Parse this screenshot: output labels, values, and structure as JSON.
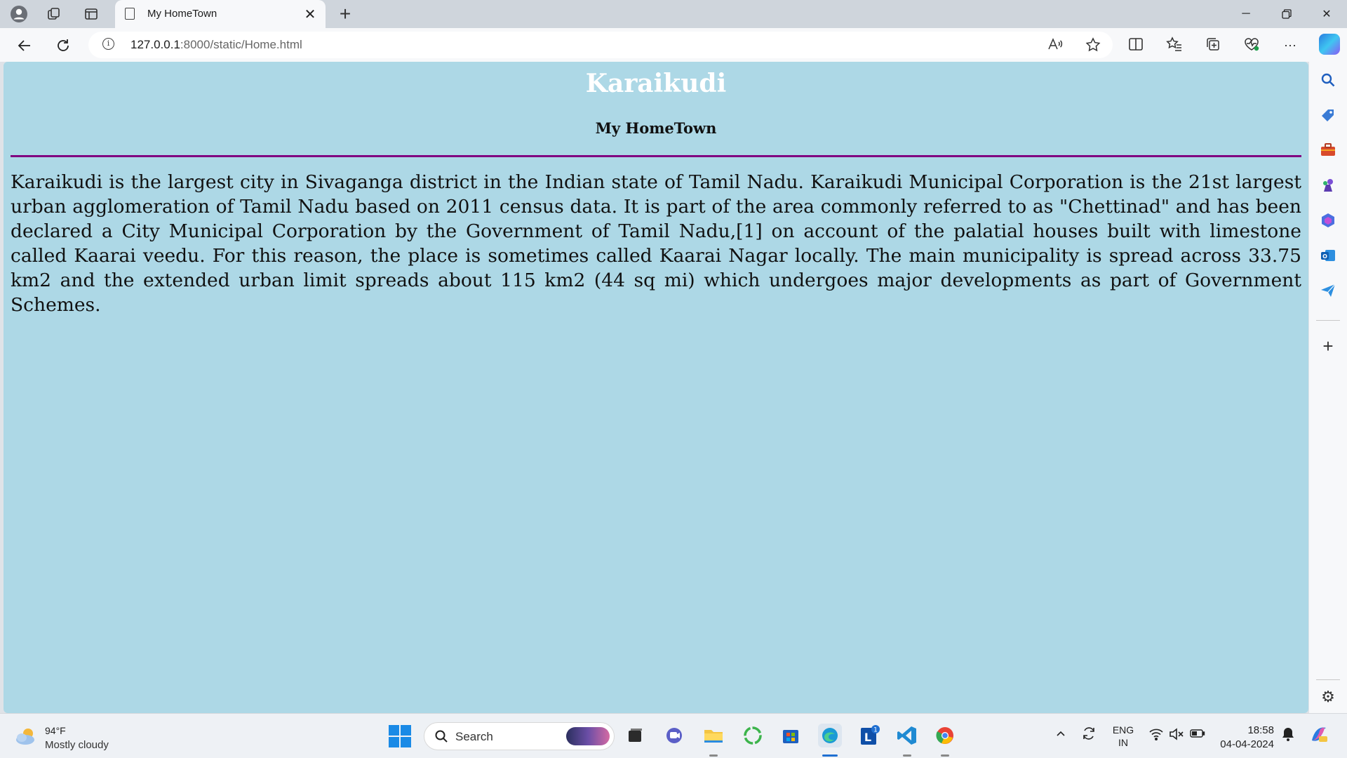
{
  "browser": {
    "tab": {
      "title": "My HomeTown"
    },
    "address": {
      "url_host": "127.0.0.1",
      "url_rest": ":8000/static/Home.html"
    }
  },
  "page": {
    "heading": "Karaikudi",
    "subheading": "My HomeTown",
    "paragraph": "Karaikudi is the largest city in Sivaganga district in the Indian state of Tamil Nadu. Karaikudi Municipal Corporation is the 21st largest urban agglomeration of Tamil Nadu based on 2011 census data. It is part of the area commonly referred to as \"Chettinad\" and has been declared a City Municipal Corporation by the Government of Tamil Nadu,[1] on account of the palatial houses built with limestone called Kaarai veedu. For this reason, the place is sometimes called Kaarai Nagar locally. The main municipality is spread across 33.75 km2 and the extended urban limit spreads about 115 km2 (44 sq mi) which undergoes major developments as part of Government Schemes.",
    "background_color": "#add8e6",
    "heading_color": "#ffffff",
    "rule_color": "#800080"
  },
  "taskbar": {
    "weather": {
      "temp": "94°F",
      "condition": "Mostly cloudy"
    },
    "search_label": "Search",
    "tray": {
      "lang_top": "ENG",
      "lang_bottom": "IN"
    },
    "clock": {
      "time": "18:58",
      "date": "04-04-2024"
    },
    "badge_count": "1"
  }
}
